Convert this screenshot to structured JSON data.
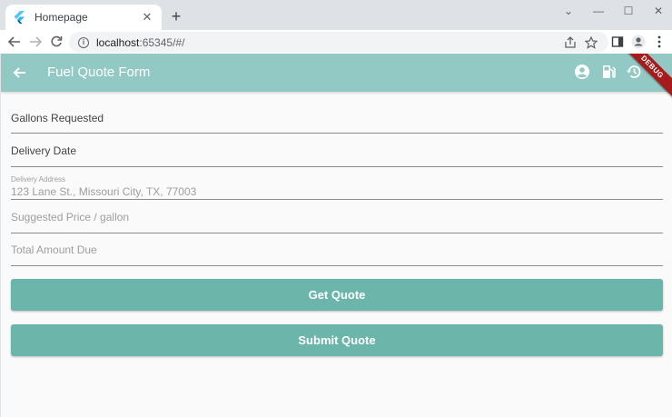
{
  "browser": {
    "tab_title": "Homepage",
    "tab_close": "✕",
    "new_tab": "+",
    "url_host": "localhost",
    "url_rest": ":65345/#/",
    "window_controls": [
      "⌄",
      "—",
      "☐",
      "✕"
    ],
    "nav_icons": [
      "arrow-left-icon",
      "arrow-right-icon",
      "reload-icon"
    ],
    "omnibox_icons": [
      "share-icon",
      "star-icon"
    ],
    "toolbar_icons": [
      "side-panel-icon",
      "profile-icon",
      "kebab-menu-icon"
    ]
  },
  "appbar": {
    "title": "Fuel Quote Form",
    "background": "#93c9c4",
    "actions": [
      "account-circle-icon",
      "fuel-pump-icon",
      "history-icon",
      "logout-icon"
    ],
    "debug_banner": "DEBUG"
  },
  "form": {
    "gallons_label": "Gallons Requested",
    "delivery_date_label": "Delivery Date",
    "address_label": "Delivery Address",
    "address_value": "123 Lane St., Missouri City, TX, 77003",
    "price_label": "Suggested Price / gallon",
    "total_label": "Total Amount Due"
  },
  "buttons": {
    "get_quote": "Get Quote",
    "submit_quote": "Submit Quote",
    "color": "#6bb5ab"
  }
}
